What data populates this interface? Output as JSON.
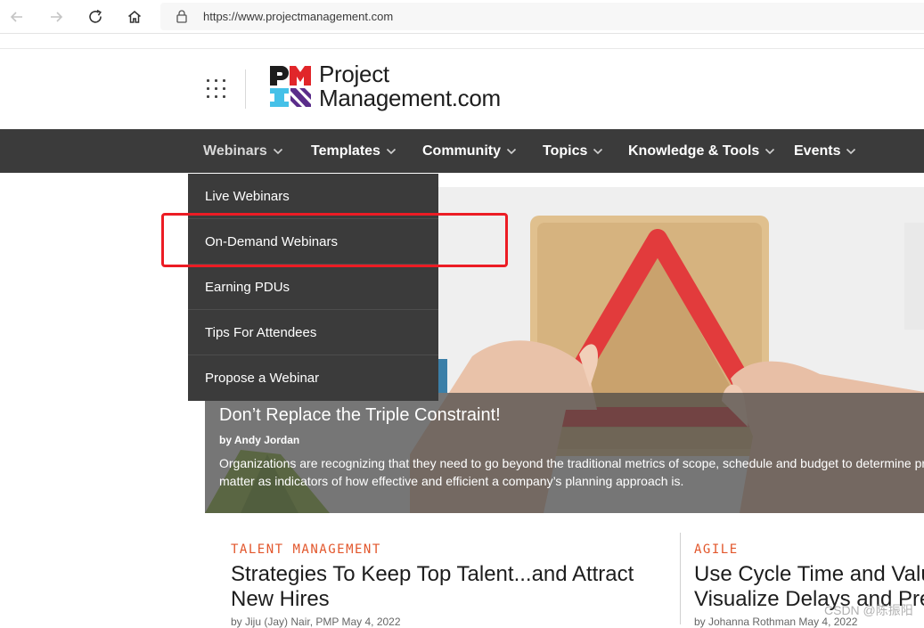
{
  "browser": {
    "url": "https://www.projectmanagement.com",
    "icons": [
      "back-arrow-icon",
      "forward-arrow-icon",
      "reload-icon",
      "home-icon",
      "lock-icon"
    ]
  },
  "site": {
    "logo_line1": "Project",
    "logo_line2": "Management.com",
    "brand_colors": {
      "red": "#e1262a",
      "purple": "#5a2c8a",
      "cyan": "#45c1e8"
    }
  },
  "nav": {
    "items": [
      {
        "label": "Webinars"
      },
      {
        "label": "Templates"
      },
      {
        "label": "Community"
      },
      {
        "label": "Topics"
      },
      {
        "label": "Knowledge & Tools"
      },
      {
        "label": "Events"
      }
    ]
  },
  "dropdown": {
    "items": [
      {
        "label": "Live Webinars"
      },
      {
        "label": "On-Demand Webinars"
      },
      {
        "label": "Earning PDUs"
      },
      {
        "label": "Tips For Attendees"
      },
      {
        "label": "Propose a Webinar"
      }
    ],
    "highlight_color": "#ec1c24"
  },
  "hero": {
    "title": "Don’t Replace the Triple Constraint!",
    "byline": "by Andy Jordan",
    "description_line1": "Organizations are recognizing that they need to go beyond the traditional metrics of scope, schedule and budget to determine pr",
    "description_line2": "matter as indicators of how effective and efficient a company’s planning approach is."
  },
  "articles": [
    {
      "category": "TALENT MANAGEMENT",
      "title_line1": "Strategies To Keep Top Talent...and Attract",
      "title_line2": "New Hires",
      "byline": "by Jiju (Jay) Nair, PMP May 4, 2022"
    },
    {
      "category": "AGILE",
      "title_line1": "Use Cycle Time and Valu",
      "title_line2": "Visualize Delays and Pre",
      "byline": "by Johanna Rothman May 4, 2022"
    }
  ],
  "watermark": "CSDN @陈振阳"
}
